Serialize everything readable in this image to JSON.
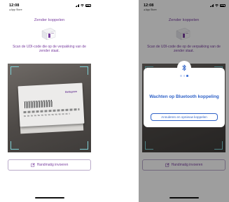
{
  "status_bar": {
    "time": "12:08",
    "back_label": "◂ App Store"
  },
  "screen_left": {
    "title": "Zender koppelen",
    "instruction": "Scan de UDI-code die op de verpakking van de zender staat.",
    "box_brand": "Bellsprew",
    "manual_button_label": "Handmatig invoeren",
    "manual_icon": "edit-icon"
  },
  "screen_right": {
    "title": "Zender koppelen",
    "instruction": "Scan de UDI-code die op de verpakking van de zender staat.",
    "manual_button_label": "Handmatig invoeren",
    "modal": {
      "icon": "bluetooth-icon",
      "page_dots": 3,
      "active_dot": 2,
      "message": "Wachten op Bluetooth koppeling",
      "cancel_label": "Annuleren en opnieuw koppelen"
    }
  },
  "colors": {
    "accent_purple": "#7a3fa0",
    "bluetooth_blue": "#2f62c8",
    "scan_corner": "#7fd1d6"
  }
}
